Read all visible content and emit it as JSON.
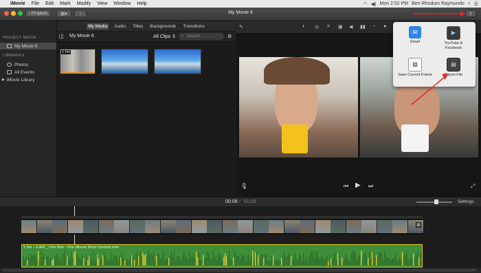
{
  "menubar": {
    "app": "iMovie",
    "items": [
      "File",
      "Edit",
      "Mark",
      "Modify",
      "View",
      "Window",
      "Help"
    ],
    "clock": "Mon 2:52 PM",
    "user": "Ben Rhodum Raymundo"
  },
  "titlebar": {
    "projects_label": "Projects",
    "window_title": "My Movie 6"
  },
  "sidebar": {
    "project_media_header": "PROJECT MEDIA",
    "project_item": "My Movie 6",
    "libraries_header": "LIBRARIES",
    "library_items": [
      "Photos",
      "All Events",
      "iMovie Library"
    ]
  },
  "browser": {
    "tabs": [
      "My Media",
      "Audio",
      "Titles",
      "Backgrounds",
      "Transitions"
    ],
    "selected_tab": "My Media",
    "project_title": "My Movie 6",
    "filter_value": "All Clips",
    "search_placeholder": "Search",
    "clip_duration_badge": "1.0m"
  },
  "share_menu": {
    "items": [
      {
        "label": "Email",
        "icon": "email-icon"
      },
      {
        "label": "YouTube & Facebook",
        "icon": "youtube-facebook-icon"
      },
      {
        "label": "Save Current Frame",
        "icon": "save-frame-icon"
      },
      {
        "label": "Export File",
        "icon": "export-file-icon"
      }
    ]
  },
  "timeline": {
    "current_time": "00:08",
    "total_time": "01:00",
    "separator": "/",
    "settings_label": "Settings",
    "audio_clip_label": "1.0m – 6 AM _ Film Riot - One Minute Short Contest.m4v"
  },
  "colors": {
    "accent_blue": "#2b6fd6",
    "audio_green": "#3f8f3a",
    "audio_border": "#e1c21c",
    "annotation_red": "#e22727"
  }
}
